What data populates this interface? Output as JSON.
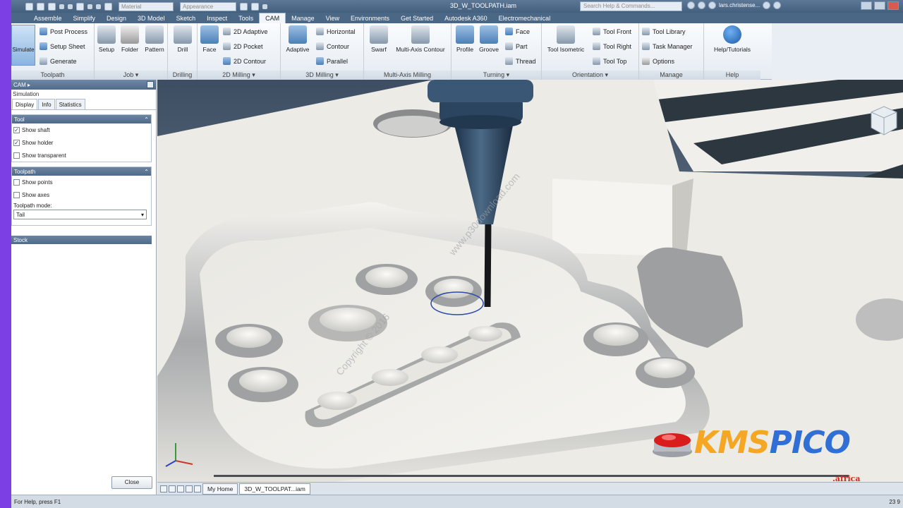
{
  "title_bar": {
    "document_title": "3D_W_TOOLPATH.iam",
    "material_placeholder": "Material",
    "appearance_placeholder": "Appearance",
    "search_placeholder": "Search Help & Commands...",
    "user_name": "lars.christense..."
  },
  "ribbon_tabs": [
    "Assemble",
    "Simplify",
    "Design",
    "3D Model",
    "Sketch",
    "Inspect",
    "Tools",
    "CAM",
    "Manage",
    "View",
    "Environments",
    "Get Started",
    "Autodesk A360",
    "Electromechanical"
  ],
  "active_tab": "CAM",
  "ribbon": {
    "toolpath": {
      "title": "Toolpath",
      "simulate": "Simulate",
      "post_process": "Post Process",
      "setup_sheet": "Setup Sheet",
      "generate": "Generate"
    },
    "job": {
      "title": "Job ▾",
      "setup": "Setup",
      "folder": "Folder",
      "pattern": "Pattern"
    },
    "drilling": {
      "title": "Drilling",
      "drill": "Drill"
    },
    "milling_2d": {
      "title": "2D Milling ▾",
      "face": "Face",
      "adaptive": "2D Adaptive",
      "pocket": "2D Pocket",
      "contour": "2D Contour"
    },
    "milling_3d": {
      "title": "3D Milling ▾",
      "adaptive": "Adaptive",
      "horizontal": "Horizontal",
      "contour": "Contour",
      "parallel": "Parallel"
    },
    "multi_axis": {
      "title": "Multi-Axis Milling",
      "swarf": "Swarf",
      "multi_axis_contour": "Multi-Axis Contour"
    },
    "turning": {
      "title": "Turning ▾",
      "profile": "Profile",
      "groove": "Groove",
      "face": "Face",
      "part": "Part",
      "thread": "Thread"
    },
    "orientation": {
      "title": "Orientation ▾",
      "tool_isometric": "Tool Isometric",
      "tool_front": "Tool Front",
      "tool_right": "Tool Right",
      "tool_top": "Tool Top"
    },
    "manage": {
      "title": "Manage",
      "tool_library": "Tool Library",
      "task_manager": "Task Manager",
      "options": "Options"
    },
    "help": {
      "title": "Help",
      "help_tutorials": "Help/Tutorials"
    }
  },
  "panel": {
    "header": "CAM ▸",
    "subheader": "Simulation",
    "tabs": [
      "Display",
      "Info",
      "Statistics"
    ],
    "tool_section": {
      "title": "Tool",
      "options": [
        {
          "label": "Show shaft",
          "checked": true
        },
        {
          "label": "Show holder",
          "checked": true
        },
        {
          "label": "Show transparent",
          "checked": false
        }
      ]
    },
    "toolpath_section": {
      "title": "Toolpath",
      "options": [
        {
          "label": "Show points",
          "checked": false
        },
        {
          "label": "Show axes",
          "checked": false
        }
      ],
      "mode_label": "Toolpath mode:",
      "mode_value": "Tail"
    },
    "stock_section": {
      "title": "Stock"
    },
    "close_label": "Close"
  },
  "doc_tabs": [
    "My Home",
    "3D_W_TOOLPAT...iam"
  ],
  "status": {
    "left": "For Help, press F1",
    "right": "23   9"
  },
  "watermark": {
    "site": "www.p30download.com",
    "copyright": "Copyright © 2016",
    "brand_main": "KMS",
    "brand_rest": "PICO",
    "brand_sub": ".africa"
  },
  "colors": {
    "ribbon_dark": "#4a6786",
    "panel_header": "#506b8b",
    "part_body": "#ecebe6",
    "tool_body": "#2d4a63",
    "frame_purple": "#7b3fe4"
  }
}
